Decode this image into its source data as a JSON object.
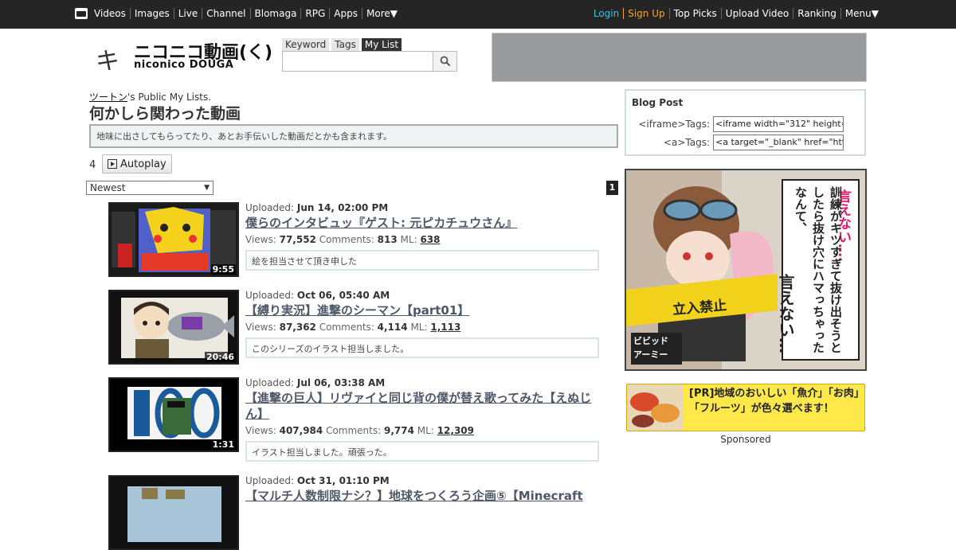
{
  "topbar": {
    "left_items": [
      "Videos",
      "Images",
      "Live",
      "Channel",
      "Blomaga",
      "RPG",
      "Apps",
      "More▼"
    ],
    "right_items": {
      "login": "Login",
      "signup": "Sign Up",
      "top_picks": "Top Picks",
      "upload": "Upload Video",
      "ranking": "Ranking",
      "menu": "Menu▼"
    }
  },
  "logo": {
    "ki": "キ",
    "main": "ニコニコ動画(く)",
    "sub": "niconico DOUGA"
  },
  "search": {
    "tabs": [
      "Keyword",
      "Tags",
      "My List"
    ],
    "active_tab": "My List",
    "value": ""
  },
  "mylist": {
    "owner_name": "ツートン",
    "owner_suffix": "'s Public My Lists.",
    "title": "何かしら関わった動画",
    "description": "地味に出さしてもらってたり、あとお手伝いした動画だとかも含まれます。",
    "count": "4",
    "autoplay_label": "Autoplay",
    "sort_value": "Newest",
    "page_number": "1"
  },
  "videos": [
    {
      "uploaded_label": "Uploaded: ",
      "uploaded": "Jun 14, 02:00 PM",
      "title": "僕らのインタビュッ『ゲスト: 元ピカチュウさん』",
      "views_label": "Views: ",
      "views": "77,552",
      "comments_label": "Comments: ",
      "comments": "813",
      "ml_label": "ML: ",
      "ml": "638",
      "duration": "9:55",
      "note": "絵を担当させて頂き申した"
    },
    {
      "uploaded_label": "Uploaded: ",
      "uploaded": "Oct 06, 05:40 AM",
      "title": "【縛り実況】進撃のシーマン【part01】",
      "views_label": "Views: ",
      "views": "87,362",
      "comments_label": "Comments: ",
      "comments": "4,114",
      "ml_label": "ML: ",
      "ml": "1,113",
      "duration": "20:46",
      "note": "このシリーズのイラスト担当しました。"
    },
    {
      "uploaded_label": "Uploaded: ",
      "uploaded": "Jul 06, 03:38 AM",
      "title": "【進撃の巨人】リヴァイと同じ背の僕が替え歌ってみた【えぬじん】",
      "views_label": "Views: ",
      "views": "407,984",
      "comments_label": "Comments: ",
      "comments": "9,774",
      "ml_label": "ML: ",
      "ml": "12,309",
      "duration": "1:31",
      "note": "イラスト担当しました。頑張った。"
    },
    {
      "uploaded_label": "Uploaded: ",
      "uploaded": "Oct 31, 01:10 PM",
      "title": "【マルチ人数制限ナシ？】地球をつくろう企画⑤【Minecraft"
    }
  ],
  "blog": {
    "title": "Blog Post",
    "iframe_label": "<iframe>Tags:",
    "iframe_value": "<iframe width=\"312\" height=\"17",
    "a_label": "<a>Tags:",
    "a_value": "<a target=\"_blank\" href=\"https"
  },
  "ad_big": {
    "text1": "言えない…",
    "text2": "訓練がキツすぎて抜け出そうとしたら抜け穴にハマっちゃったなんて、",
    "text3": "言えない…",
    "sign": "立入禁止",
    "logo_top": "ビビッド",
    "logo_bottom": "アーミー"
  },
  "ad_small": {
    "text": "[PR]地域のおいしい「魚介」「お肉」「フルーツ」が色々選べます！"
  },
  "sponsored": "Sponsored"
}
